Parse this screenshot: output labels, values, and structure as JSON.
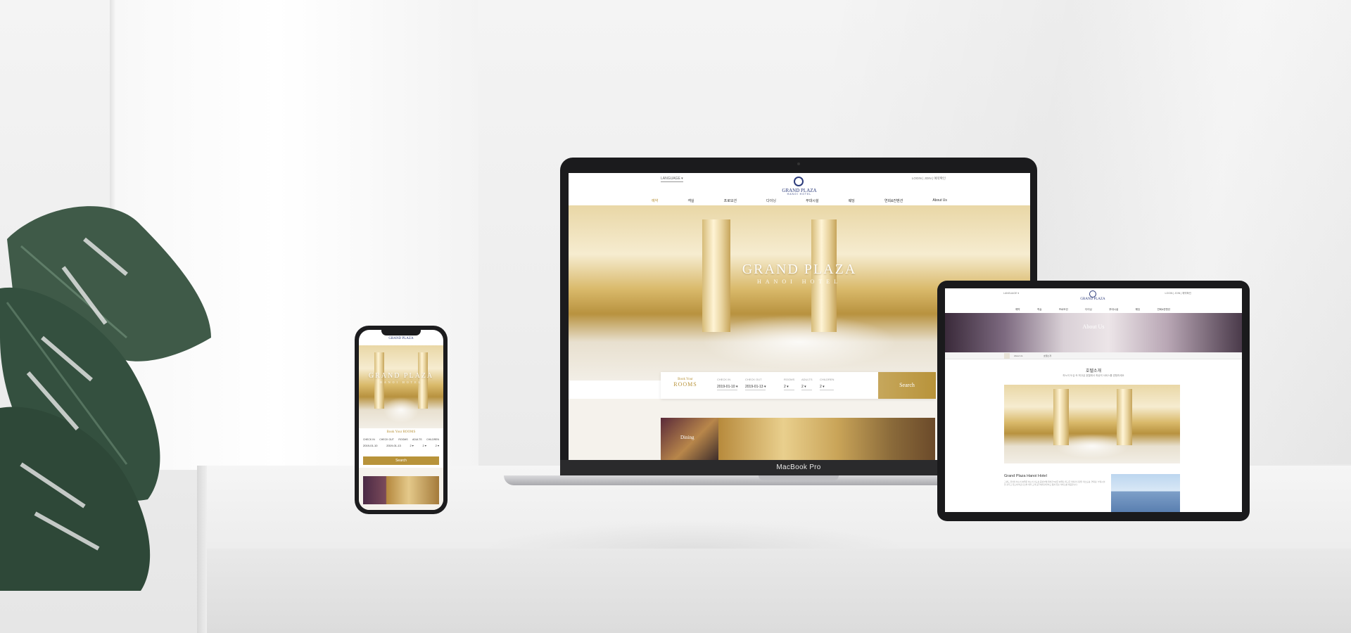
{
  "laptop": {
    "device_label": "MacBook Pro",
    "lang": "LANGUAGE ▾",
    "util": "LOGIN  |  JOIN  |  예약확인",
    "logo": "GRAND PLAZA",
    "logo_sub": "HANOI HOTEL",
    "nav": [
      "예약",
      "객실",
      "프로모션",
      "다이닝",
      "부대시설",
      "웨딩",
      "연회&컨벤션",
      "About Us"
    ],
    "hero_title": "GRAND PLAZA",
    "hero_sub": "HANOI HOTEL",
    "booking": {
      "title_small": "Book Your",
      "title_big": "ROOMS",
      "checkin_label": "CHECK IN",
      "checkin_value": "2019-01-10 ▾",
      "checkout_label": "CHECK OUT",
      "checkout_value": "2019-01-13 ▾",
      "rooms_label": "ROOMS",
      "rooms_value": "2 ▾",
      "adults_label": "ADULTS",
      "adults_value": "2 ▾",
      "children_label": "CHILDREN",
      "children_value": "2 ▾",
      "search": "Search"
    },
    "thumb_label": "Dining"
  },
  "phone": {
    "logo": "GRAND PLAZA",
    "hero_title": "GRAND PLAZA",
    "hero_sub": "HANOI HOTEL",
    "booking_title": "Book Your ROOMS",
    "labels": [
      "CHECK IN",
      "CHECK OUT",
      "ROOMS",
      "ADULTS",
      "CHILDREN"
    ],
    "values": [
      "2019-01-10",
      "2019-01-13",
      "2 ▾",
      "2 ▾",
      "2 ▾"
    ],
    "search": "Search"
  },
  "tablet": {
    "lang": "LANGUAGE ▾",
    "util": "LOGIN | JOIN | 예약확인",
    "logo": "GRAND PLAZA",
    "nav": [
      "예약",
      "객실",
      "프로모션",
      "다이닝",
      "부대시설",
      "웨딩",
      "연회&컨벤션"
    ],
    "banner_title": "About Us",
    "crumb_a": "About Us",
    "crumb_b": "호텔소개",
    "heading": "호텔소개",
    "subheading": "하노이 도심 속 최고급 호텔에서 최상의 서비스를 경험하세요",
    "section_title": "Grand Plaza Hanoi Hotel",
    "paragraph": "그랜드 플라자 하노이 호텔은 하노이 신도심 중심부에 위치한 5성급 호텔로 최고급 객실과 다양한 레스토랑, 연회장, 부대시설을 갖추고 있으며 비즈니스와 레저 고객 모두에게 편안하고 품격 있는 서비스를 제공합니다."
  },
  "colors": {
    "gold": "#b8933a",
    "navy_logo": "#2b3a7a",
    "cream": "#f5f2ec"
  }
}
